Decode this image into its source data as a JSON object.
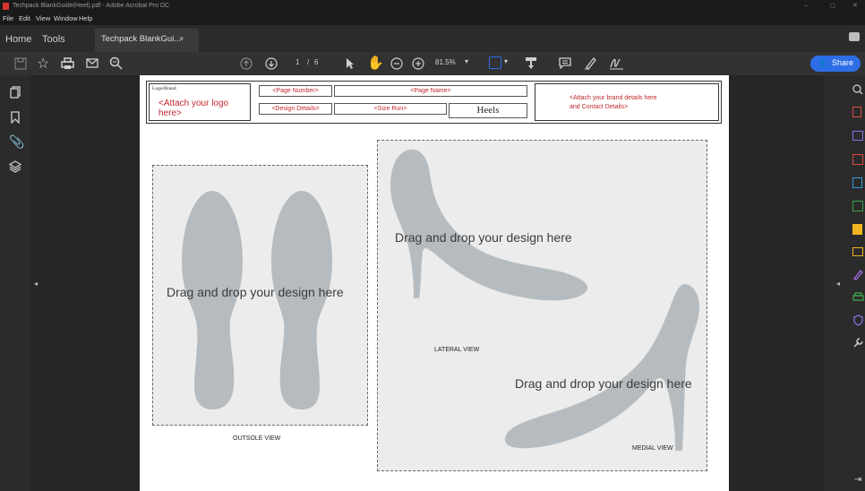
{
  "window": {
    "title": "Techpack BlankGuide(Heel).pdf - Adobe Acrobat Pro DC"
  },
  "menu": [
    "File",
    "Edit",
    "View",
    "Window",
    "Help"
  ],
  "tabs": {
    "home": "Home",
    "tools": "Tools",
    "doc": "Techpack BlankGui...",
    "close": "×"
  },
  "toolbar": {
    "page_current": "1",
    "page_sep": "/",
    "page_total": "6",
    "zoom": "81.5%",
    "zoom_arrow": "▾",
    "share": "Share"
  },
  "header": {
    "logo_label": "Logo/Brand",
    "logo_text": "<Attach your logo here>",
    "page_number": "<Page Number>",
    "page_name": "<Page Name>",
    "design_details": "<Design Details>",
    "size_run": "<Size Run>",
    "product": "Heels",
    "brand_details_1": "<Attach your brand details here",
    "brand_details_2": "and Contact Details>"
  },
  "canvas": {
    "outsole_drop": "Drag and drop your design here",
    "outsole_caption": "OUTSOLE VIEW",
    "lateral_drop": "Drag and drop your design here",
    "lateral_caption": "LATERAL VIEW",
    "medial_drop": "Drag and drop your design here",
    "medial_caption": "MEDIAL VIEW"
  },
  "colors": {
    "accent_blue": "#2d6ee6",
    "brand_red": "#c0282d",
    "shoe_gray": "#b5bbbf"
  }
}
